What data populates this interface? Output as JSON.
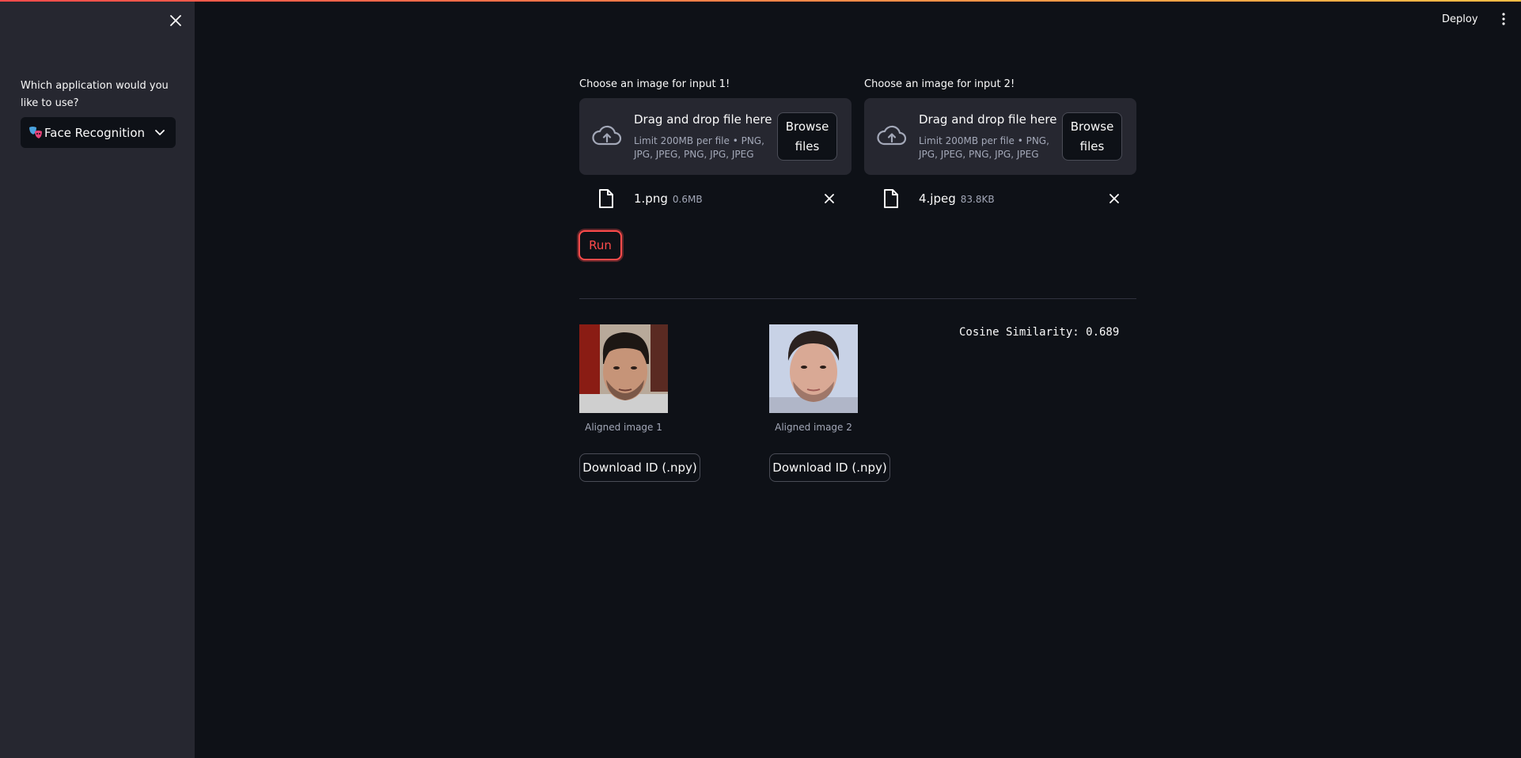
{
  "sidebar": {
    "question": "Which application would you like to use?",
    "selected_app": "Face Recognition",
    "selected_app_icon": "masks-icon"
  },
  "header": {
    "deploy_label": "Deploy"
  },
  "uploaders": [
    {
      "label": "Choose an image for input 1!",
      "drop_title": "Drag and drop file here",
      "drop_limit": "Limit 200MB per file • PNG, JPG, JPEG, PNG, JPG, JPEG",
      "browse_label": "Browse files",
      "file_name": "1.png",
      "file_size": "0.6MB"
    },
    {
      "label": "Choose an image for input 2!",
      "drop_title": "Drag and drop file here",
      "drop_limit": "Limit 200MB per file • PNG, JPG, JPEG, PNG, JPG, JPEG",
      "browse_label": "Browse files",
      "file_name": "4.jpeg",
      "file_size": "83.8KB"
    }
  ],
  "run_label": "Run",
  "results": {
    "images": [
      {
        "caption": "Aligned image 1",
        "download_label": "Download ID (.npy)"
      },
      {
        "caption": "Aligned image 2",
        "download_label": "Download ID (.npy)"
      }
    ],
    "cosine_text": "Cosine Similarity: 0.689"
  },
  "colors": {
    "background": "#0e1117",
    "sidebar": "#262730",
    "accent": "#ff4b4b"
  }
}
